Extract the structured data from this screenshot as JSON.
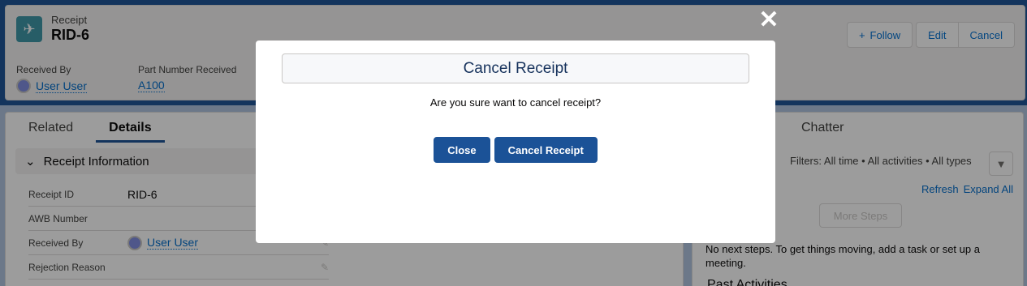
{
  "header": {
    "object_label": "Receipt",
    "record_name": "RID-6",
    "buttons": {
      "follow": "Follow",
      "edit": "Edit",
      "cancel": "Cancel"
    },
    "highlights": [
      {
        "label": "Received By",
        "value": "User User"
      },
      {
        "label": "Part Number Received",
        "value": "A100"
      }
    ]
  },
  "left_panel": {
    "tabs": [
      "Related",
      "Details"
    ],
    "section_title": "Receipt Information",
    "fields": [
      {
        "label": "Receipt ID",
        "value": "RID-6"
      },
      {
        "label": "AWB Number",
        "value": ""
      },
      {
        "label": "Received By",
        "value": "User User"
      },
      {
        "label": "Rejection Reason",
        "value": ""
      }
    ]
  },
  "right_panel": {
    "tab": "Chatter",
    "filters": "Filters: All time • All activities • All types",
    "refresh": "Refresh",
    "expand_all": "Expand All",
    "more_steps": "More Steps",
    "next_steps_text": "No next steps. To get things moving, add a task or set up a meeting.",
    "past_activities": "Past Activities"
  },
  "modal": {
    "title": "Cancel Receipt",
    "message": "Are you sure want to cancel receipt?",
    "close_label": "Close",
    "confirm_label": "Cancel Receipt"
  },
  "colors": {
    "brand": "#1b5297",
    "link": "#006dcc",
    "record_icon": "#3c97a7"
  }
}
